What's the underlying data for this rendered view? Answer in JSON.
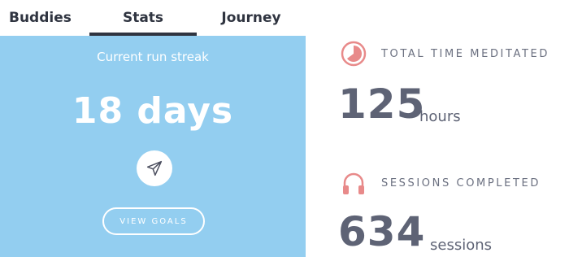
{
  "tabs": [
    {
      "label": "Buddies",
      "active": false
    },
    {
      "label": "Stats",
      "active": true
    },
    {
      "label": "Journey",
      "active": false
    }
  ],
  "streak": {
    "label": "Current run streak",
    "value": "18 days",
    "share_icon": "paper-plane-icon",
    "goals_label": "VIEW GOALS",
    "background": "#93cef0"
  },
  "stats": [
    {
      "title": "TOTAL TIME MEDITATED",
      "value": "125",
      "unit": "hours",
      "icon": "pie-timer-icon",
      "icon_color": "#e88a8a"
    },
    {
      "title": "SESSIONS COMPLETED",
      "value": "634",
      "unit": "sessions",
      "icon": "headphones-icon",
      "icon_color": "#e88a8a"
    }
  ],
  "colors": {
    "text_dark": "#2f3440",
    "stat_text": "#5e6375",
    "accent": "#e88a8a"
  }
}
